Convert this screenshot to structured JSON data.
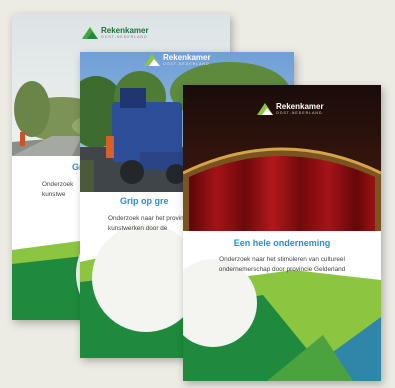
{
  "covers": [
    {
      "logo": {
        "name": "Rekenkamer",
        "sub": "OOST-NEDERLAND"
      },
      "title": "Gr",
      "subtitle_lines": [
        "Onderzoek",
        "kunstwe"
      ]
    },
    {
      "logo": {
        "name": "Rekenkamer",
        "sub": "OOST-NEDERLAND"
      },
      "title": "Grip op gre",
      "subtitle_lines": [
        "Onderzoek naar het provinc",
        "kunstwerken door de"
      ]
    },
    {
      "logo": {
        "name": "Rekenkamer",
        "sub": "OOST-NEDERLAND"
      },
      "title": "Een hele onderneming",
      "subtitle_lines": [
        "Onderzoek naar het stimuleren van cultureel",
        "ondernemerschap door provincie Gelderland"
      ]
    }
  ],
  "colors": {
    "background": "#ecebe4",
    "title_blue": "#2b8ec9",
    "green_dark": "#1f8a3e",
    "green_mid": "#4aa33f",
    "green_light": "#8cc53f",
    "teal": "#2f86a8",
    "curtain": "#8a0f12"
  },
  "icons": [
    "rekenkamer-logo-icon"
  ]
}
